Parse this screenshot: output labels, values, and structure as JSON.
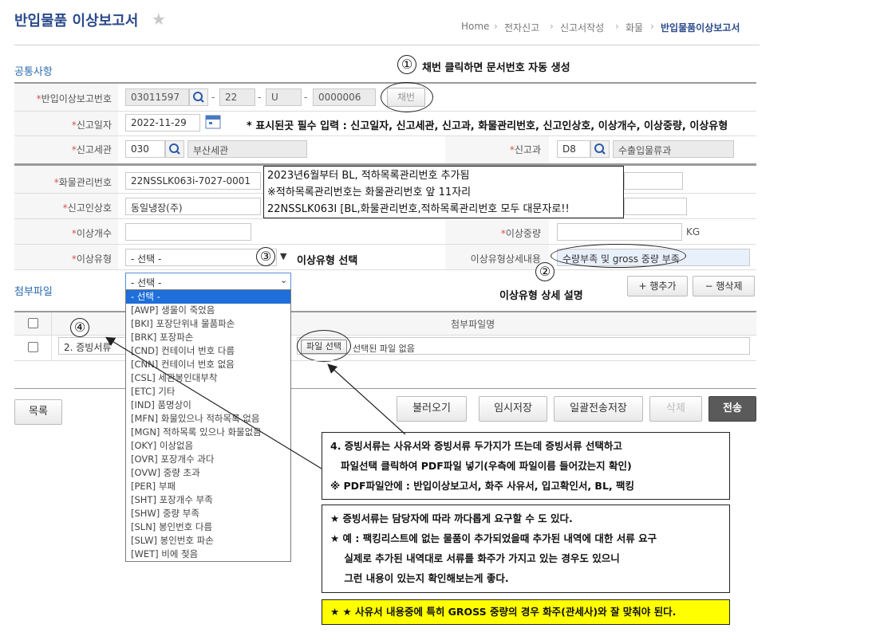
{
  "page": {
    "title": "반입물품 이상보고서",
    "breadcrumb": [
      "Home",
      "전자신고",
      "신고서작성",
      "화물",
      "반입물품이상보고서"
    ],
    "section_common": "공통사항",
    "section_attach": "첨부파일"
  },
  "form": {
    "report_no": {
      "label": "반입이상보고번호",
      "part1": "03011597",
      "part2": "22",
      "part3": "U",
      "part4": "0000006",
      "issue_button": "채번"
    },
    "report_date": {
      "label": "신고일자",
      "value": "2022-11-29"
    },
    "customs": {
      "label": "신고세관",
      "code": "030",
      "name": "부산세관"
    },
    "division": {
      "label": "신고과",
      "code": "D8",
      "name": "수출입물류과"
    },
    "cargo_no": {
      "label": "화물관리번호",
      "value": "22NSSLK063i-7027-0001"
    },
    "declarant": {
      "label": "신고인상호",
      "value": "동일냉장(주)"
    },
    "count": {
      "label": "이상개수",
      "value": ""
    },
    "weight": {
      "label": "이상중량",
      "value": "",
      "unit": "KG"
    },
    "type": {
      "label": "이상유형",
      "value": "- 선택 -"
    },
    "type_detail": {
      "label": "이상유형상세내용",
      "value": "수량부족 및 gross 중량 부족"
    }
  },
  "attach": {
    "add_row": "+ 행추가",
    "del_row": "− 행삭제",
    "col_name": "첨부파일명",
    "row_type": "2. 증빙서류",
    "file_button": "파일 선택",
    "file_status": "선택된 파일 없음"
  },
  "dropdown": {
    "selected": "- 선택 -",
    "options": [
      "- 선택 -",
      "[AWP] 생물이 죽었음",
      "[BKI] 포장단위내 물품파손",
      "[BRK] 포장파손",
      "[CND] 컨테이너 번호 다름",
      "[CNN] 컨테이너 번호 없음",
      "[CSL] 세관봉인대부착",
      "[ETC] 기타",
      "[IND] 품명상이",
      "[MFN] 화물있으나 적하목록 없음",
      "[MGN] 적하목록 있으나 화물없음",
      "[OKY] 이상없음",
      "[OVR] 포장개수 과다",
      "[OVW] 중량 초과",
      "[PER] 부패",
      "[SHT] 포장개수 부족",
      "[SHW] 중량 부족",
      "[SLN] 봉인번호 다름",
      "[SLW] 봉인번호 파손",
      "[WET] 비에 젖음"
    ]
  },
  "buttons": {
    "list": "목록",
    "load": "불러오기",
    "temp_save": "임시저장",
    "batch_save": "일괄전송저장",
    "delete": "삭제",
    "send": "전송"
  },
  "annotations": {
    "n1": "①",
    "n2": "②",
    "n3": "③",
    "n4": "④",
    "a1": "채번 클릭하면 문서번호 자동 생성",
    "req_note": "* 표시된곳 필수 입력 : 신고일자, 신고세관, 신고과, 화물관리번호, 신고인상호, 이상개수, 이상중량, 이상유형",
    "a3": "이상유형 선택",
    "a2": "이상유형 상세 설명",
    "cargo_note": [
      "2023년6월부터 BL, 적하목록관리번호 추가됨",
      "※적하목록관리번호는 화물관리번호 앞 11자리",
      "22NSSLK063I [BL,화물관리번호,적하목록관리번호 모두 대문자로!!"
    ],
    "box4": [
      "4. 증빙서류는 사유서와 증빙서류 두가지가 뜨는데 증빙서류 선택하고",
      "   파일선택 클릭하여 PDF파일 넣기(우측에 파일이름 들어갔는지 확인)",
      "※ PDF파일안에 : 반입이상보고서, 화주 사유서, 입고확인서, BL, 팩킹"
    ],
    "box5": [
      "★ 증빙서류는 담당자에 따라 까다롭게 요구할 수 도 있다.",
      "★ 예 : 팩킹리스트에 없는 물품이 추가되었을때 추가된 내역에 대한 서류 요구",
      "    실제로 추가된 내역대로 서류를 화주가 가지고 있는 경우도 있으니",
      "    그런 내용이 있는지 확인해보는게 좋다."
    ],
    "box6": "★ ★ 사유서 내용중에 특히 GROSS 중량의 경우 화주(관세사)와 잘 맞춰야 된다."
  },
  "colors": {
    "title": "#2b4a8b",
    "section": "#2b6cb0",
    "required": "#d9534f",
    "highlight": "#ffff00",
    "dropdown_selected": "#1e6fd9"
  }
}
